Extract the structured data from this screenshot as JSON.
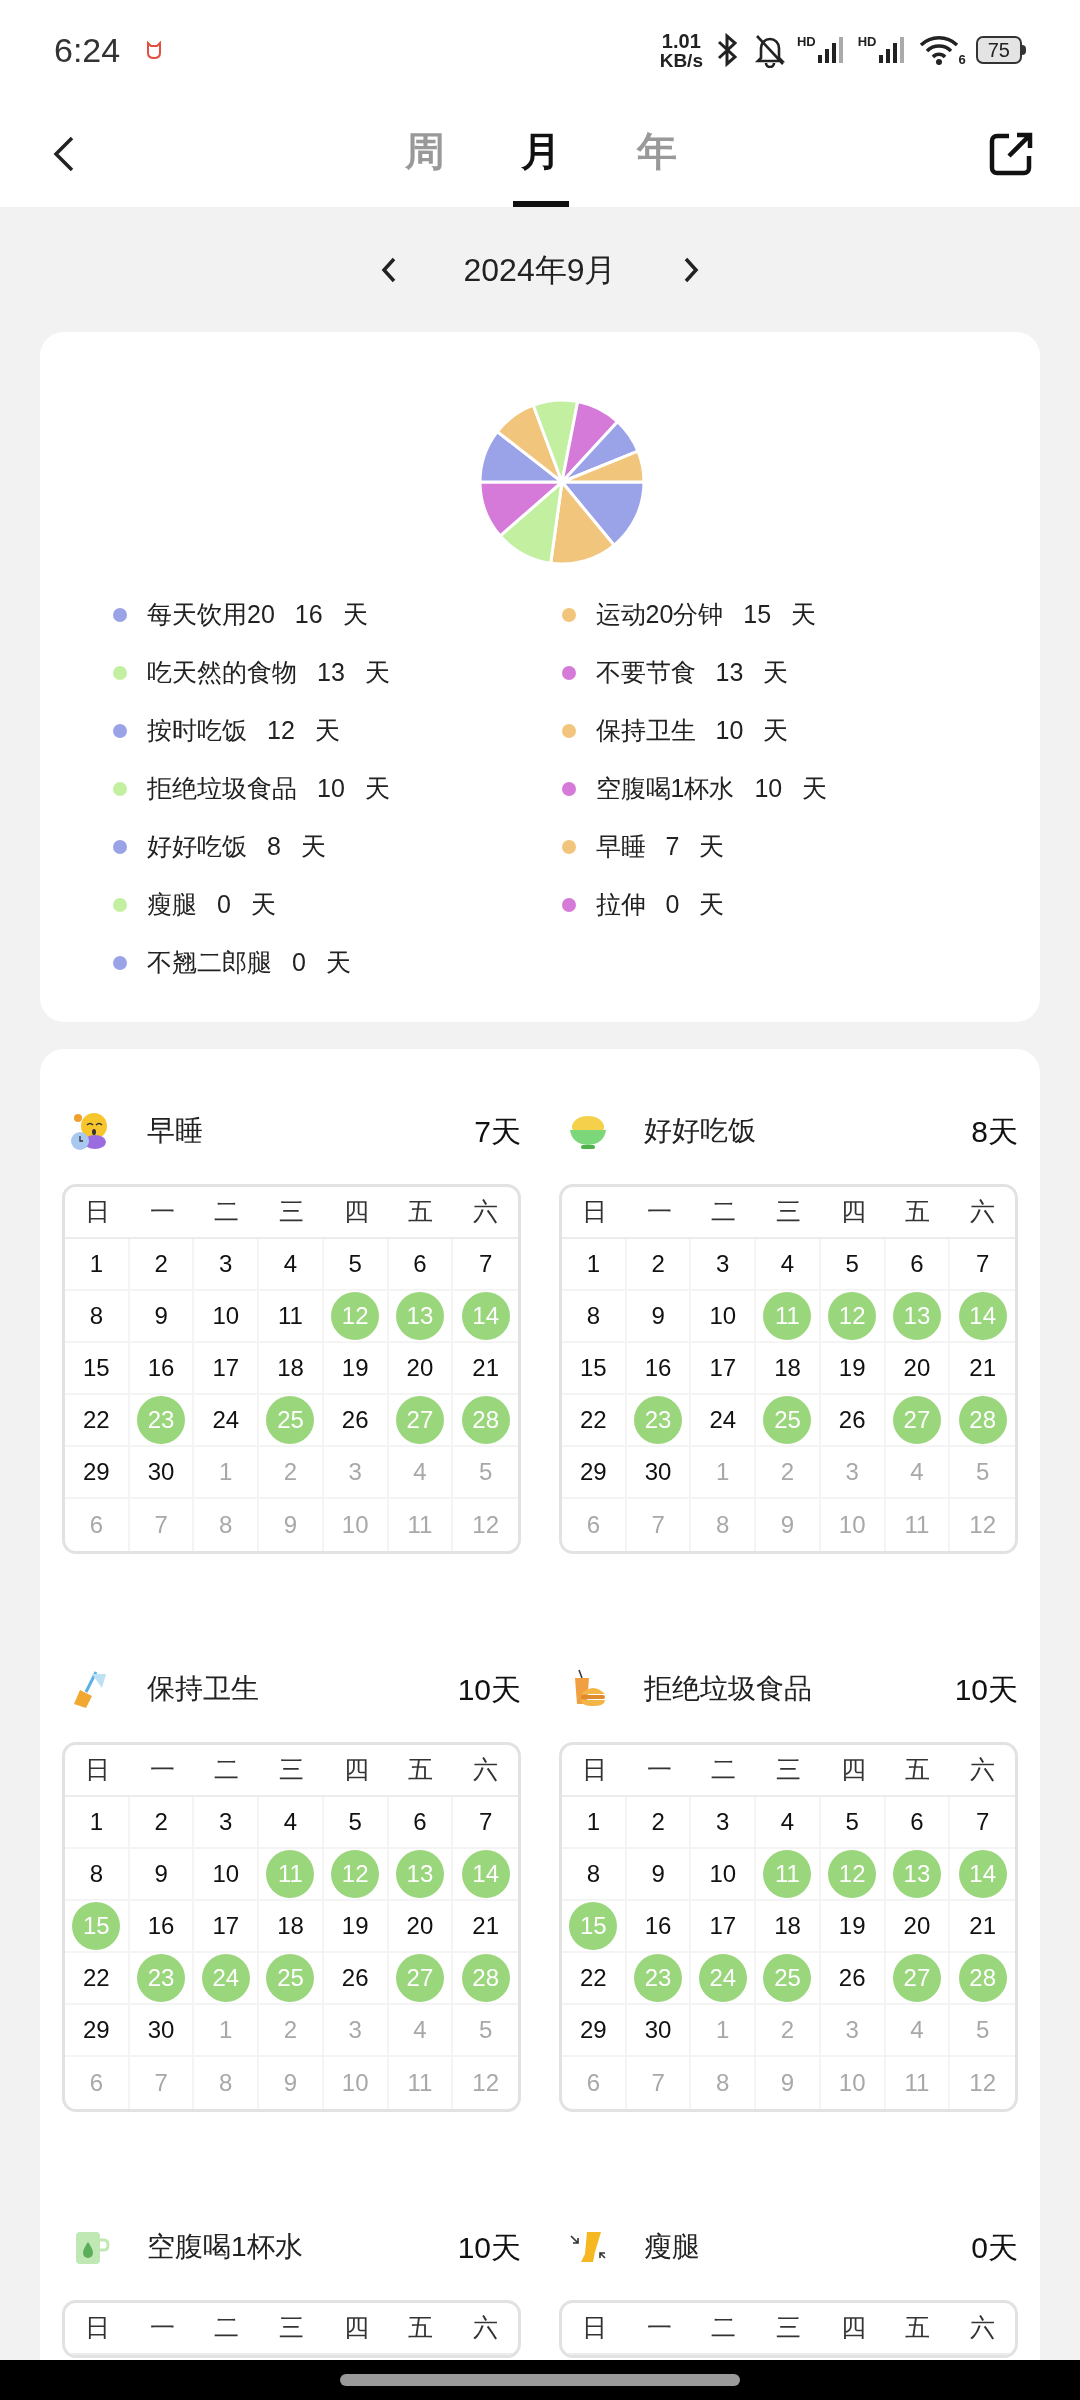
{
  "status_bar": {
    "time": "6:24",
    "speed_value": "1.01",
    "speed_unit": "KB/s",
    "sim_1": "HD",
    "sim_2": "HD",
    "wifi_standard": "6",
    "battery": "75"
  },
  "nav": {
    "tabs": [
      {
        "label": "周",
        "selected": false
      },
      {
        "label": "月",
        "selected": true
      },
      {
        "label": "年",
        "selected": false
      }
    ]
  },
  "month_nav": {
    "title": "2024年9月"
  },
  "summary": {
    "chart_data": {
      "type": "pie",
      "values": [
        14.04,
        13.16,
        11.4,
        11.4,
        10.53,
        8.77,
        8.77,
        8.77,
        7.02,
        6.14
      ]
    },
    "legend": [
      {
        "name": "每天饮用20",
        "count": "16",
        "unit": "天",
        "color": "#9ba3e8"
      },
      {
        "name": "运动20分钟",
        "count": "15",
        "unit": "天",
        "color": "#f2c57c"
      },
      {
        "name": "吃天然的食物",
        "count": "13",
        "unit": "天",
        "color": "#c2f0a0"
      },
      {
        "name": "不要节食",
        "count": "13",
        "unit": "天",
        "color": "#d67ad9"
      },
      {
        "name": "按时吃饭",
        "count": "12",
        "unit": "天",
        "color": "#9ba3e8"
      },
      {
        "name": "保持卫生",
        "count": "10",
        "unit": "天",
        "color": "#f2c57c"
      },
      {
        "name": "拒绝垃圾食品",
        "count": "10",
        "unit": "天",
        "color": "#c2f0a0"
      },
      {
        "name": "空腹喝1杯水",
        "count": "10",
        "unit": "天",
        "color": "#d67ad9"
      },
      {
        "name": "好好吃饭",
        "count": "8",
        "unit": "天",
        "color": "#9ba3e8"
      },
      {
        "name": "早睡",
        "count": "7",
        "unit": "天",
        "color": "#f2c57c"
      },
      {
        "name": "瘦腿",
        "count": "0",
        "unit": "天",
        "color": "#c2f0a0"
      },
      {
        "name": "拉伸",
        "count": "0",
        "unit": "天",
        "color": "#d67ad9"
      },
      {
        "name": "不翘二郎腿",
        "count": "0",
        "unit": "天",
        "color": "#9ba3e8"
      }
    ]
  },
  "habits": [
    {
      "kind": "sleep",
      "name": "早睡",
      "total": "7天",
      "weekdays": [
        "日",
        "一",
        "二",
        "三",
        "四",
        "五",
        "六"
      ],
      "weeks": [
        [
          {
            "day": "1",
            "in_month": true,
            "done": false
          },
          {
            "day": "2",
            "in_month": true,
            "done": false
          },
          {
            "day": "3",
            "in_month": true,
            "done": false
          },
          {
            "day": "4",
            "in_month": true,
            "done": false
          },
          {
            "day": "5",
            "in_month": true,
            "done": false
          },
          {
            "day": "6",
            "in_month": true,
            "done": false
          },
          {
            "day": "7",
            "in_month": true,
            "done": false
          }
        ],
        [
          {
            "day": "8",
            "in_month": true,
            "done": false
          },
          {
            "day": "9",
            "in_month": true,
            "done": false
          },
          {
            "day": "10",
            "in_month": true,
            "done": false
          },
          {
            "day": "11",
            "in_month": true,
            "done": false
          },
          {
            "day": "12",
            "in_month": true,
            "done": true
          },
          {
            "day": "13",
            "in_month": true,
            "done": true
          },
          {
            "day": "14",
            "in_month": true,
            "done": true
          }
        ],
        [
          {
            "day": "15",
            "in_month": true,
            "done": false
          },
          {
            "day": "16",
            "in_month": true,
            "done": false
          },
          {
            "day": "17",
            "in_month": true,
            "done": false
          },
          {
            "day": "18",
            "in_month": true,
            "done": false
          },
          {
            "day": "19",
            "in_month": true,
            "done": false
          },
          {
            "day": "20",
            "in_month": true,
            "done": false
          },
          {
            "day": "21",
            "in_month": true,
            "done": false
          }
        ],
        [
          {
            "day": "22",
            "in_month": true,
            "done": false
          },
          {
            "day": "23",
            "in_month": true,
            "done": true
          },
          {
            "day": "24",
            "in_month": true,
            "done": false
          },
          {
            "day": "25",
            "in_month": true,
            "done": true
          },
          {
            "day": "26",
            "in_month": true,
            "done": false
          },
          {
            "day": "27",
            "in_month": true,
            "done": true
          },
          {
            "day": "28",
            "in_month": true,
            "done": true
          }
        ],
        [
          {
            "day": "29",
            "in_month": true,
            "done": false
          },
          {
            "day": "30",
            "in_month": true,
            "done": false
          },
          {
            "day": "1",
            "in_month": false,
            "done": false
          },
          {
            "day": "2",
            "in_month": false,
            "done": false
          },
          {
            "day": "3",
            "in_month": false,
            "done": false
          },
          {
            "day": "4",
            "in_month": false,
            "done": false
          },
          {
            "day": "5",
            "in_month": false,
            "done": false
          }
        ],
        [
          {
            "day": "6",
            "in_month": false,
            "done": false
          },
          {
            "day": "7",
            "in_month": false,
            "done": false
          },
          {
            "day": "8",
            "in_month": false,
            "done": false
          },
          {
            "day": "9",
            "in_month": false,
            "done": false
          },
          {
            "day": "10",
            "in_month": false,
            "done": false
          },
          {
            "day": "11",
            "in_month": false,
            "done": false
          },
          {
            "day": "12",
            "in_month": false,
            "done": false
          }
        ]
      ]
    },
    {
      "kind": "rice_bowl",
      "name": "好好吃饭",
      "total": "8天",
      "weekdays": [
        "日",
        "一",
        "二",
        "三",
        "四",
        "五",
        "六"
      ],
      "weeks": [
        [
          {
            "day": "1",
            "in_month": true,
            "done": false
          },
          {
            "day": "2",
            "in_month": true,
            "done": false
          },
          {
            "day": "3",
            "in_month": true,
            "done": false
          },
          {
            "day": "4",
            "in_month": true,
            "done": false
          },
          {
            "day": "5",
            "in_month": true,
            "done": false
          },
          {
            "day": "6",
            "in_month": true,
            "done": false
          },
          {
            "day": "7",
            "in_month": true,
            "done": false
          }
        ],
        [
          {
            "day": "8",
            "in_month": true,
            "done": false
          },
          {
            "day": "9",
            "in_month": true,
            "done": false
          },
          {
            "day": "10",
            "in_month": true,
            "done": false
          },
          {
            "day": "11",
            "in_month": true,
            "done": true
          },
          {
            "day": "12",
            "in_month": true,
            "done": true
          },
          {
            "day": "13",
            "in_month": true,
            "done": true
          },
          {
            "day": "14",
            "in_month": true,
            "done": true
          }
        ],
        [
          {
            "day": "15",
            "in_month": true,
            "done": false
          },
          {
            "day": "16",
            "in_month": true,
            "done": false
          },
          {
            "day": "17",
            "in_month": true,
            "done": false
          },
          {
            "day": "18",
            "in_month": true,
            "done": false
          },
          {
            "day": "19",
            "in_month": true,
            "done": false
          },
          {
            "day": "20",
            "in_month": true,
            "done": false
          },
          {
            "day": "21",
            "in_month": true,
            "done": false
          }
        ],
        [
          {
            "day": "22",
            "in_month": true,
            "done": false
          },
          {
            "day": "23",
            "in_month": true,
            "done": true
          },
          {
            "day": "24",
            "in_month": true,
            "done": false
          },
          {
            "day": "25",
            "in_month": true,
            "done": true
          },
          {
            "day": "26",
            "in_month": true,
            "done": false
          },
          {
            "day": "27",
            "in_month": true,
            "done": true
          },
          {
            "day": "28",
            "in_month": true,
            "done": true
          }
        ],
        [
          {
            "day": "29",
            "in_month": true,
            "done": false
          },
          {
            "day": "30",
            "in_month": true,
            "done": false
          },
          {
            "day": "1",
            "in_month": false,
            "done": false
          },
          {
            "day": "2",
            "in_month": false,
            "done": false
          },
          {
            "day": "3",
            "in_month": false,
            "done": false
          },
          {
            "day": "4",
            "in_month": false,
            "done": false
          },
          {
            "day": "5",
            "in_month": false,
            "done": false
          }
        ],
        [
          {
            "day": "6",
            "in_month": false,
            "done": false
          },
          {
            "day": "7",
            "in_month": false,
            "done": false
          },
          {
            "day": "8",
            "in_month": false,
            "done": false
          },
          {
            "day": "9",
            "in_month": false,
            "done": false
          },
          {
            "day": "10",
            "in_month": false,
            "done": false
          },
          {
            "day": "11",
            "in_month": false,
            "done": false
          },
          {
            "day": "12",
            "in_month": false,
            "done": false
          }
        ]
      ]
    },
    {
      "kind": "broom",
      "name": "保持卫生",
      "total": "10天",
      "weekdays": [
        "日",
        "一",
        "二",
        "三",
        "四",
        "五",
        "六"
      ],
      "weeks": [
        [
          {
            "day": "1",
            "in_month": true,
            "done": false
          },
          {
            "day": "2",
            "in_month": true,
            "done": false
          },
          {
            "day": "3",
            "in_month": true,
            "done": false
          },
          {
            "day": "4",
            "in_month": true,
            "done": false
          },
          {
            "day": "5",
            "in_month": true,
            "done": false
          },
          {
            "day": "6",
            "in_month": true,
            "done": false
          },
          {
            "day": "7",
            "in_month": true,
            "done": false
          }
        ],
        [
          {
            "day": "8",
            "in_month": true,
            "done": false
          },
          {
            "day": "9",
            "in_month": true,
            "done": false
          },
          {
            "day": "10",
            "in_month": true,
            "done": false
          },
          {
            "day": "11",
            "in_month": true,
            "done": true
          },
          {
            "day": "12",
            "in_month": true,
            "done": true
          },
          {
            "day": "13",
            "in_month": true,
            "done": true
          },
          {
            "day": "14",
            "in_month": true,
            "done": true
          }
        ],
        [
          {
            "day": "15",
            "in_month": true,
            "done": true
          },
          {
            "day": "16",
            "in_month": true,
            "done": false
          },
          {
            "day": "17",
            "in_month": true,
            "done": false
          },
          {
            "day": "18",
            "in_month": true,
            "done": false
          },
          {
            "day": "19",
            "in_month": true,
            "done": false
          },
          {
            "day": "20",
            "in_month": true,
            "done": false
          },
          {
            "day": "21",
            "in_month": true,
            "done": false
          }
        ],
        [
          {
            "day": "22",
            "in_month": true,
            "done": false
          },
          {
            "day": "23",
            "in_month": true,
            "done": true
          },
          {
            "day": "24",
            "in_month": true,
            "done": true
          },
          {
            "day": "25",
            "in_month": true,
            "done": true
          },
          {
            "day": "26",
            "in_month": true,
            "done": false
          },
          {
            "day": "27",
            "in_month": true,
            "done": true
          },
          {
            "day": "28",
            "in_month": true,
            "done": true
          }
        ],
        [
          {
            "day": "29",
            "in_month": true,
            "done": false
          },
          {
            "day": "30",
            "in_month": true,
            "done": false
          },
          {
            "day": "1",
            "in_month": false,
            "done": false
          },
          {
            "day": "2",
            "in_month": false,
            "done": false
          },
          {
            "day": "3",
            "in_month": false,
            "done": false
          },
          {
            "day": "4",
            "in_month": false,
            "done": false
          },
          {
            "day": "5",
            "in_month": false,
            "done": false
          }
        ],
        [
          {
            "day": "6",
            "in_month": false,
            "done": false
          },
          {
            "day": "7",
            "in_month": false,
            "done": false
          },
          {
            "day": "8",
            "in_month": false,
            "done": false
          },
          {
            "day": "9",
            "in_month": false,
            "done": false
          },
          {
            "day": "10",
            "in_month": false,
            "done": false
          },
          {
            "day": "11",
            "in_month": false,
            "done": false
          },
          {
            "day": "12",
            "in_month": false,
            "done": false
          }
        ]
      ]
    },
    {
      "kind": "junk_food",
      "name": "拒绝垃圾食品",
      "total": "10天",
      "weekdays": [
        "日",
        "一",
        "二",
        "三",
        "四",
        "五",
        "六"
      ],
      "weeks": [
        [
          {
            "day": "1",
            "in_month": true,
            "done": false
          },
          {
            "day": "2",
            "in_month": true,
            "done": false
          },
          {
            "day": "3",
            "in_month": true,
            "done": false
          },
          {
            "day": "4",
            "in_month": true,
            "done": false
          },
          {
            "day": "5",
            "in_month": true,
            "done": false
          },
          {
            "day": "6",
            "in_month": true,
            "done": false
          },
          {
            "day": "7",
            "in_month": true,
            "done": false
          }
        ],
        [
          {
            "day": "8",
            "in_month": true,
            "done": false
          },
          {
            "day": "9",
            "in_month": true,
            "done": false
          },
          {
            "day": "10",
            "in_month": true,
            "done": false
          },
          {
            "day": "11",
            "in_month": true,
            "done": true
          },
          {
            "day": "12",
            "in_month": true,
            "done": true
          },
          {
            "day": "13",
            "in_month": true,
            "done": true
          },
          {
            "day": "14",
            "in_month": true,
            "done": true
          }
        ],
        [
          {
            "day": "15",
            "in_month": true,
            "done": true
          },
          {
            "day": "16",
            "in_month": true,
            "done": false
          },
          {
            "day": "17",
            "in_month": true,
            "done": false
          },
          {
            "day": "18",
            "in_month": true,
            "done": false
          },
          {
            "day": "19",
            "in_month": true,
            "done": false
          },
          {
            "day": "20",
            "in_month": true,
            "done": false
          },
          {
            "day": "21",
            "in_month": true,
            "done": false
          }
        ],
        [
          {
            "day": "22",
            "in_month": true,
            "done": false
          },
          {
            "day": "23",
            "in_month": true,
            "done": true
          },
          {
            "day": "24",
            "in_month": true,
            "done": true
          },
          {
            "day": "25",
            "in_month": true,
            "done": true
          },
          {
            "day": "26",
            "in_month": true,
            "done": false
          },
          {
            "day": "27",
            "in_month": true,
            "done": true
          },
          {
            "day": "28",
            "in_month": true,
            "done": true
          }
        ],
        [
          {
            "day": "29",
            "in_month": true,
            "done": false
          },
          {
            "day": "30",
            "in_month": true,
            "done": false
          },
          {
            "day": "1",
            "in_month": false,
            "done": false
          },
          {
            "day": "2",
            "in_month": false,
            "done": false
          },
          {
            "day": "3",
            "in_month": false,
            "done": false
          },
          {
            "day": "4",
            "in_month": false,
            "done": false
          },
          {
            "day": "5",
            "in_month": false,
            "done": false
          }
        ],
        [
          {
            "day": "6",
            "in_month": false,
            "done": false
          },
          {
            "day": "7",
            "in_month": false,
            "done": false
          },
          {
            "day": "8",
            "in_month": false,
            "done": false
          },
          {
            "day": "9",
            "in_month": false,
            "done": false
          },
          {
            "day": "10",
            "in_month": false,
            "done": false
          },
          {
            "day": "11",
            "in_month": false,
            "done": false
          },
          {
            "day": "12",
            "in_month": false,
            "done": false
          }
        ]
      ]
    },
    {
      "kind": "water_cup",
      "name": "空腹喝1杯水",
      "total": "10天",
      "weekdays": [
        "日",
        "一",
        "二",
        "三",
        "四",
        "五",
        "六"
      ]
    },
    {
      "kind": "leg",
      "name": "瘦腿",
      "total": "0天",
      "weekdays": [
        "日",
        "一",
        "二",
        "三",
        "四",
        "五",
        "六"
      ]
    }
  ]
}
